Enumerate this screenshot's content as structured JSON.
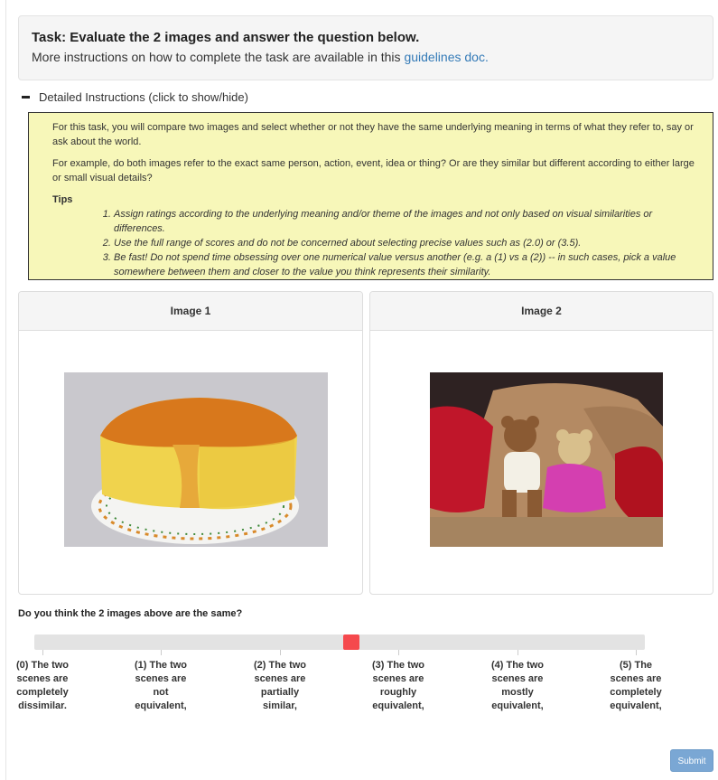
{
  "task": {
    "title": "Task: Evaluate the 2 images and answer the question below.",
    "subtitle_prefix": "More instructions on how to complete the task are available in this ",
    "guidelines_link": "guidelines doc."
  },
  "instructions": {
    "toggle_label": "Detailed Instructions (click to show/hide)",
    "para1": "For this task, you will compare two images and select whether or not they have the same underlying meaning in terms of what they refer to, say or ask about the world.",
    "para2": "For example, do both images refer to the exact same person, action, event, idea or thing? Or are they similar but different according to either large or small visual details?",
    "tips_label": "Tips",
    "tips": [
      "Assign ratings according to the underlying meaning and/or theme of the images and not only based on visual similarities or differences.",
      "Use the full range of scores and do not be concerned about selecting precise values such as (2.0) or (3.5).",
      "Be fast! Do not spend time obsessing over one numerical value versus another (e.g. a (1) vs a (2)) -- in such cases, pick a value somewhere between them and closer to the value you think represents their similarity."
    ]
  },
  "images": {
    "image1_label": "Image 1",
    "image2_label": "Image 2"
  },
  "question": {
    "text": "Do you think the 2 images above are the same?",
    "slider_value": 2.6,
    "slider_min": 0,
    "slider_max": 5,
    "scale_labels": [
      "(0) The two scenes are completely dissimilar.",
      "(1) The two scenes are not equivalent,",
      "(2) The two scenes are partially similar,",
      "(3) The two scenes are roughly equivalent,",
      "(4) The two scenes are mostly equivalent,",
      "(5) The scenes are completely equivalent,"
    ]
  },
  "submit_label": "Submit",
  "colors": {
    "slider_handle": "#f5494d",
    "link": "#337ab7",
    "instructions_bg": "#f7f7b9",
    "submit_bg": "#7aa7d4"
  }
}
